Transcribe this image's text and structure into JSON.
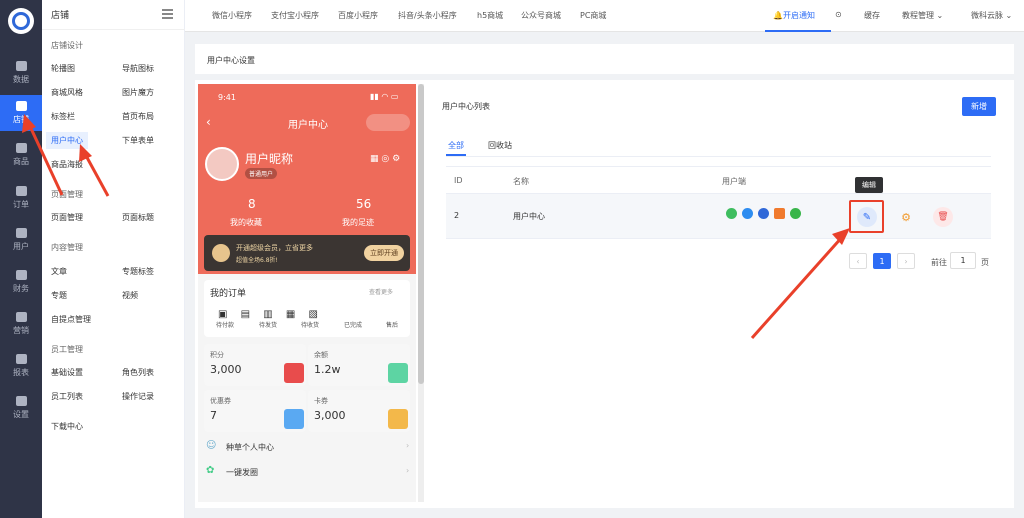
{
  "rail": {
    "items": [
      "数据",
      "店铺",
      "商品",
      "订单",
      "用户",
      "财务",
      "营销",
      "报表",
      "设置"
    ]
  },
  "menu": {
    "title": "店铺",
    "groups": [
      {
        "label": "店铺设计"
      },
      {
        "label": "页面管理"
      },
      {
        "label": "内容管理"
      },
      {
        "label": "员工管理"
      }
    ],
    "items": [
      "轮播图",
      "导航图标",
      "商城风格",
      "图片魔方",
      "标签栏",
      "首页布局",
      "用户中心",
      "下单表单",
      "商品海报",
      "页面管理",
      "页面标题",
      "文章",
      "专题标签",
      "专题",
      "视频",
      "自提点管理",
      "基础设置",
      "角色列表",
      "员工列表",
      "操作记录",
      "下载中心"
    ]
  },
  "topbar": {
    "tabs": [
      "微信小程序",
      "支付宝小程序",
      "百度小程序",
      "抖音/头条小程序",
      "h5商城",
      "公众号商城",
      "PC商城"
    ],
    "notice": "开启通知",
    "cache": "缓存",
    "tutorial": "教程管理",
    "brand": "微科云脉"
  },
  "page": {
    "title": "用户中心设置"
  },
  "phone": {
    "time": "9:41",
    "header": "用户中心",
    "nickname": "用户昵称",
    "user_level": "普通用户",
    "fav_count": "8",
    "fav_label": "我的收藏",
    "trail_count": "56",
    "trail_label": "我的足迹",
    "vip_text": "开通超级会员，立省更多",
    "vip_sub": "超值全场6.8折!",
    "vip_btn": "立即开通",
    "orders_title": "我的订单",
    "orders_more": "查看更多",
    "order_items": [
      "待付款",
      "待发货",
      "待收货",
      "已完成",
      "售后"
    ],
    "stats": [
      {
        "label": "积分",
        "value": "3,000"
      },
      {
        "label": "余额",
        "value": "1.2w"
      },
      {
        "label": "优惠券",
        "value": "7"
      },
      {
        "label": "卡券",
        "value": "3,000"
      }
    ],
    "links": [
      "种草个人中心",
      "一键发圈"
    ]
  },
  "list": {
    "title": "用户中心列表",
    "new_btn": "新增",
    "tabs": [
      "全部",
      "回收站"
    ],
    "columns": [
      "ID",
      "名称",
      "用户端"
    ],
    "rows": [
      {
        "id": "2",
        "name": "用户中心"
      }
    ],
    "tooltip": "编辑",
    "pager": {
      "page": "1",
      "goto": "前往",
      "input": "1",
      "unit": "页"
    }
  },
  "colors": {
    "accent": "#2d6cf5",
    "phone_header": "#ee6b5a",
    "arrow": "#e9402a"
  }
}
